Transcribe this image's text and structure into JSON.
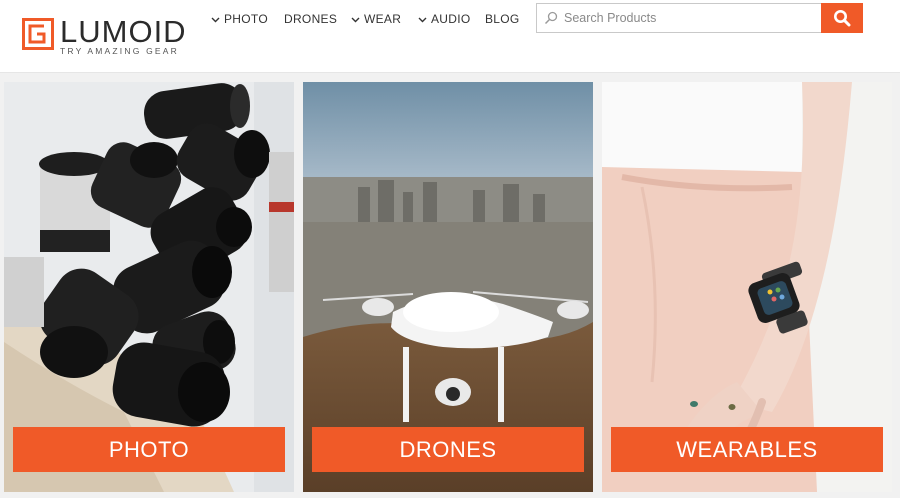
{
  "brand": {
    "name": "LUMOID",
    "tagline": "TRY AMAZING GEAR",
    "accent_color": "#f05a28"
  },
  "nav": {
    "items": [
      {
        "label": "PHOTO",
        "has_dropdown": true
      },
      {
        "label": "DRONES",
        "has_dropdown": false
      },
      {
        "label": "WEAR",
        "has_dropdown": true
      },
      {
        "label": "AUDIO",
        "has_dropdown": true
      },
      {
        "label": "BLOG",
        "has_dropdown": false
      }
    ]
  },
  "search": {
    "placeholder": "Search Products",
    "value": "",
    "icon": "search-icon"
  },
  "categories": [
    {
      "label": "PHOTO",
      "image": "camera-lenses-in-tote-bag"
    },
    {
      "label": "DRONES",
      "image": "white-drone-over-city"
    },
    {
      "label": "WEARABLES",
      "image": "smartwatch-on-wrist"
    }
  ]
}
